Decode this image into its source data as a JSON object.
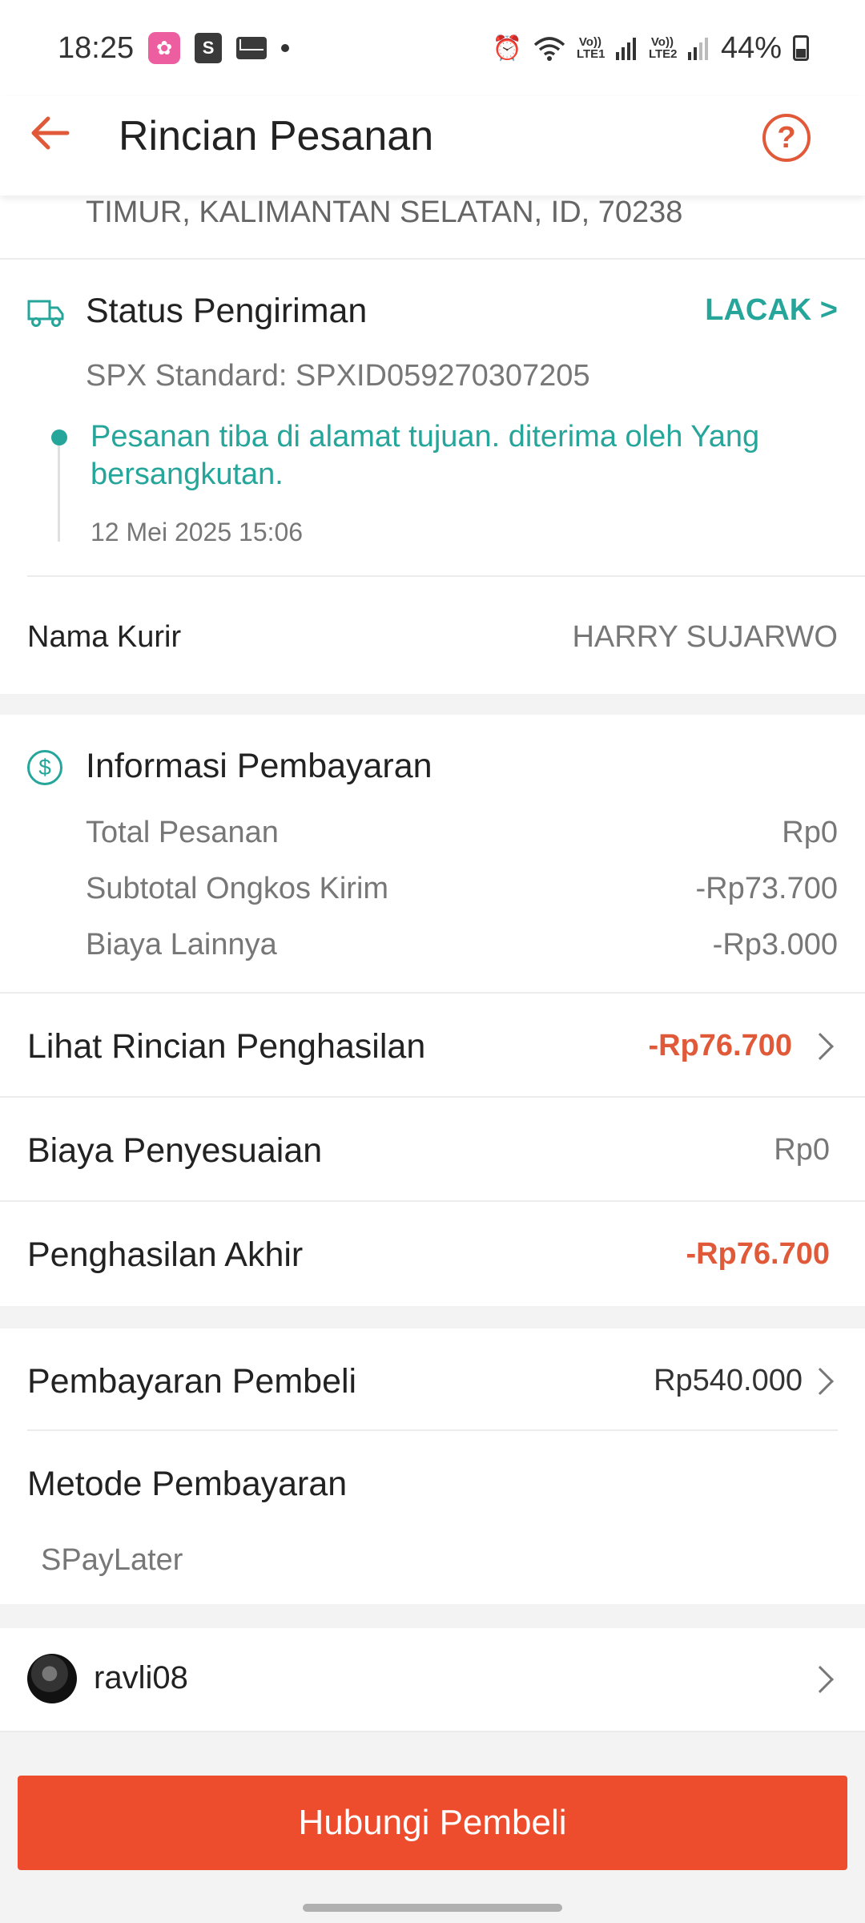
{
  "status_bar": {
    "time": "18:25",
    "battery": "44%",
    "sim1": "Vo)) LTE1",
    "sim2": "Vo)) LTE2",
    "icons": [
      "photo-app-icon",
      "shopping-bag-icon",
      "mail-icon",
      "alarm-icon",
      "wifi-icon",
      "signal-icon",
      "battery-icon"
    ]
  },
  "header": {
    "title": "Rincian Pesanan",
    "help_icon": "?"
  },
  "address": {
    "line": "TIMUR, KALIMANTAN SELATAN, ID, 70238"
  },
  "shipping": {
    "title": "Status Pengiriman",
    "track_label": "LACAK >",
    "service": "SPX Standard: SPXID059270307205",
    "event": "Pesanan tiba di alamat tujuan. diterima oleh Yang bersangkutan.",
    "event_time": "12 Mei 2025 15:06",
    "courier_label": "Nama Kurir",
    "courier_name": "HARRY SUJARWO"
  },
  "payment_info": {
    "title": "Informasi Pembayaran",
    "rows": [
      {
        "label": "Total Pesanan",
        "value": "Rp0"
      },
      {
        "label": "Subtotal Ongkos Kirim",
        "value": "-Rp73.700"
      },
      {
        "label": "Biaya Lainnya",
        "value": "-Rp3.000"
      }
    ]
  },
  "income": {
    "details_label": "Lihat Rincian Penghasilan",
    "details_value": "-Rp76.700",
    "adjustment_label": "Biaya Penyesuaian",
    "adjustment_value": "Rp0",
    "final_label": "Penghasilan Akhir",
    "final_value": "-Rp76.700"
  },
  "buyer_payment": {
    "label": "Pembayaran Pembeli",
    "value": "Rp540.000",
    "method_label": "Metode Pembayaran",
    "method_value": "SPayLater"
  },
  "buyer": {
    "username": "ravli08"
  },
  "bottom": {
    "contact_button": "Hubungi Pembeli"
  },
  "colors": {
    "accent": "#ee4d2d",
    "teal": "#26a69a",
    "negative": "#e05a3a"
  }
}
